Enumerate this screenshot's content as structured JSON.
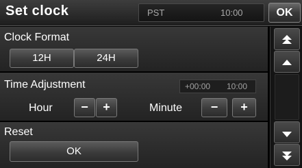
{
  "header": {
    "title": "Set clock",
    "timezone": "PST",
    "time": "10:00",
    "ok_label": "OK"
  },
  "clock_format": {
    "label": "Clock Format",
    "option_12h": "12H",
    "option_24h": "24H"
  },
  "time_adjustment": {
    "label": "Time Adjustment",
    "offset": "+00:00",
    "adjusted_time": "10:00",
    "hour_label": "Hour",
    "minute_label": "Minute",
    "minus": "−",
    "plus": "+"
  },
  "reset": {
    "label": "Reset",
    "ok_label": "OK"
  },
  "icons": {
    "scroll_top": "double-up-arrow-icon",
    "scroll_up": "up-arrow-icon",
    "scroll_down": "down-arrow-icon",
    "scroll_bottom": "double-down-arrow-icon"
  }
}
